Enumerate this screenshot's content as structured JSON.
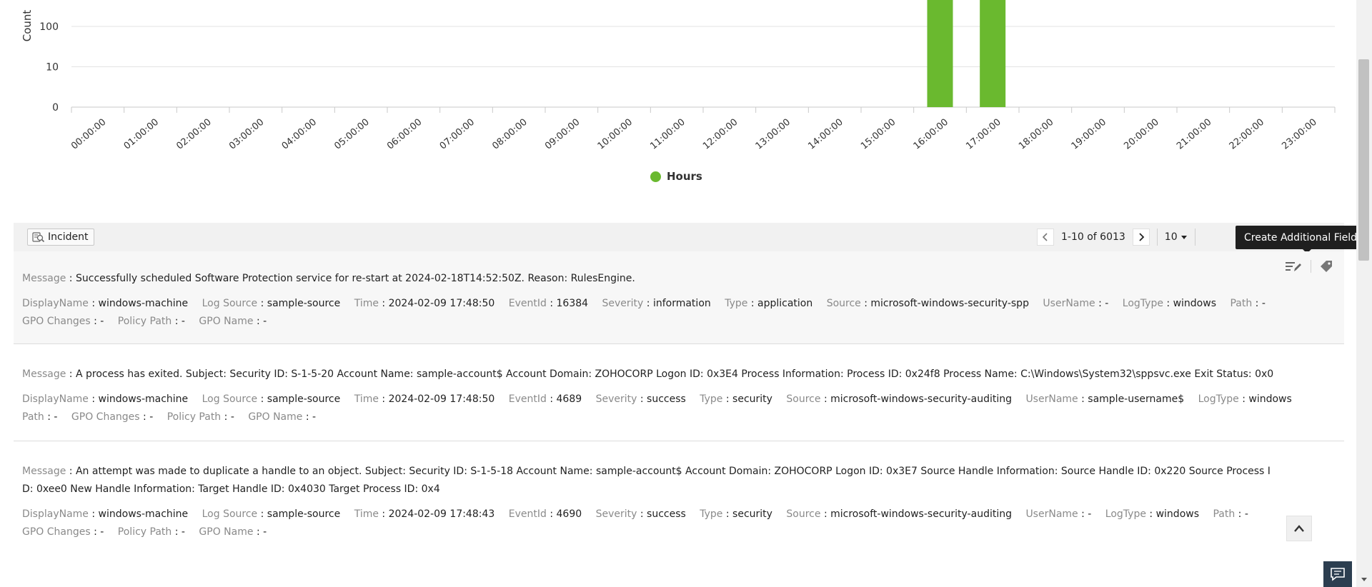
{
  "chart_data": {
    "type": "bar",
    "ylabel": "Count",
    "y_scale": "log",
    "y_ticks": [
      "0",
      "10",
      "100"
    ],
    "categories": [
      "00:00:00",
      "01:00:00",
      "02:00:00",
      "03:00:00",
      "04:00:00",
      "05:00:00",
      "06:00:00",
      "07:00:00",
      "08:00:00",
      "09:00:00",
      "10:00:00",
      "11:00:00",
      "12:00:00",
      "13:00:00",
      "14:00:00",
      "15:00:00",
      "16:00:00",
      "17:00:00",
      "18:00:00",
      "19:00:00",
      "20:00:00",
      "21:00:00",
      "22:00:00",
      "23:00:00"
    ],
    "series": [
      {
        "name": "Hours",
        "color": "#6ab92f",
        "values": [
          0,
          0,
          0,
          0,
          0,
          0,
          0,
          0,
          0,
          0,
          0,
          0,
          0,
          0,
          0,
          0,
          3200,
          2800,
          0,
          0,
          0,
          0,
          0,
          0
        ]
      }
    ],
    "legend": "bottom-center"
  },
  "toolbar": {
    "incident_label": "Incident",
    "pagination": "1-10 of 6013",
    "per_page": "10",
    "tooltip": "Create Additional Fields"
  },
  "logs": [
    {
      "message": "Successfully scheduled Software Protection service for re-start at 2024-02-18T14:52:50Z. Reason: RulesEngine.",
      "fields": [
        {
          "label": "DisplayName",
          "value": "windows-machine"
        },
        {
          "label": "Log Source",
          "value": "sample-source"
        },
        {
          "label": "Time",
          "value": "2024-02-09 17:48:50"
        },
        {
          "label": "EventId",
          "value": "16384"
        },
        {
          "label": "Severity",
          "value": "information"
        },
        {
          "label": "Type",
          "value": "application"
        },
        {
          "label": "Source",
          "value": "microsoft-windows-security-spp"
        },
        {
          "label": "UserName",
          "value": "-"
        },
        {
          "label": "LogType",
          "value": "windows"
        },
        {
          "label": "Path",
          "value": "-"
        },
        {
          "label": "GPO Changes",
          "value": "-"
        },
        {
          "label": "Policy Path",
          "value": "-"
        },
        {
          "label": "GPO Name",
          "value": "-"
        }
      ]
    },
    {
      "message": "A process has exited. Subject: Security ID: S-1-5-20 Account Name: sample-account$ Account Domain: ZOHOCORP Logon ID: 0x3E4 Process Information: Process ID: 0x24f8 Process Name: C:\\Windows\\System32\\sppsvc.exe Exit Status: 0x0",
      "fields": [
        {
          "label": "DisplayName",
          "value": "windows-machine"
        },
        {
          "label": "Log Source",
          "value": "sample-source"
        },
        {
          "label": "Time",
          "value": "2024-02-09 17:48:50"
        },
        {
          "label": "EventId",
          "value": "4689"
        },
        {
          "label": "Severity",
          "value": "success"
        },
        {
          "label": "Type",
          "value": "security"
        },
        {
          "label": "Source",
          "value": "microsoft-windows-security-auditing"
        },
        {
          "label": "UserName",
          "value": "sample-username$"
        },
        {
          "label": "LogType",
          "value": "windows"
        },
        {
          "label": "Path",
          "value": "-"
        },
        {
          "label": "GPO Changes",
          "value": "-"
        },
        {
          "label": "Policy Path",
          "value": "-"
        },
        {
          "label": "GPO Name",
          "value": "-"
        }
      ]
    },
    {
      "message": "An attempt was made to duplicate a handle to an object. Subject: Security ID: S-1-5-18 Account Name: sample-account$ Account Domain: ZOHOCORP Logon ID: 0x3E7 Source Handle Information: Source Handle ID: 0x220 Source Process ID: 0xee0 New Handle Information: Target Handle ID: 0x4030 Target Process ID: 0x4",
      "fields": [
        {
          "label": "DisplayName",
          "value": "windows-machine"
        },
        {
          "label": "Log Source",
          "value": "sample-source"
        },
        {
          "label": "Time",
          "value": "2024-02-09 17:48:43"
        },
        {
          "label": "EventId",
          "value": "4690"
        },
        {
          "label": "Severity",
          "value": "success"
        },
        {
          "label": "Type",
          "value": "security"
        },
        {
          "label": "Source",
          "value": "microsoft-windows-security-auditing"
        },
        {
          "label": "UserName",
          "value": "-"
        },
        {
          "label": "LogType",
          "value": "windows"
        },
        {
          "label": "Path",
          "value": "-"
        },
        {
          "label": "GPO Changes",
          "value": "-"
        },
        {
          "label": "Policy Path",
          "value": "-"
        },
        {
          "label": "GPO Name",
          "value": "-"
        }
      ]
    }
  ],
  "message_label": "Message",
  "icons": {
    "incident": "incident-search-icon",
    "edit": "edit-list-icon",
    "tag": "tag-icon",
    "back_top": "chevron-up-icon",
    "chat": "chat-icon"
  }
}
